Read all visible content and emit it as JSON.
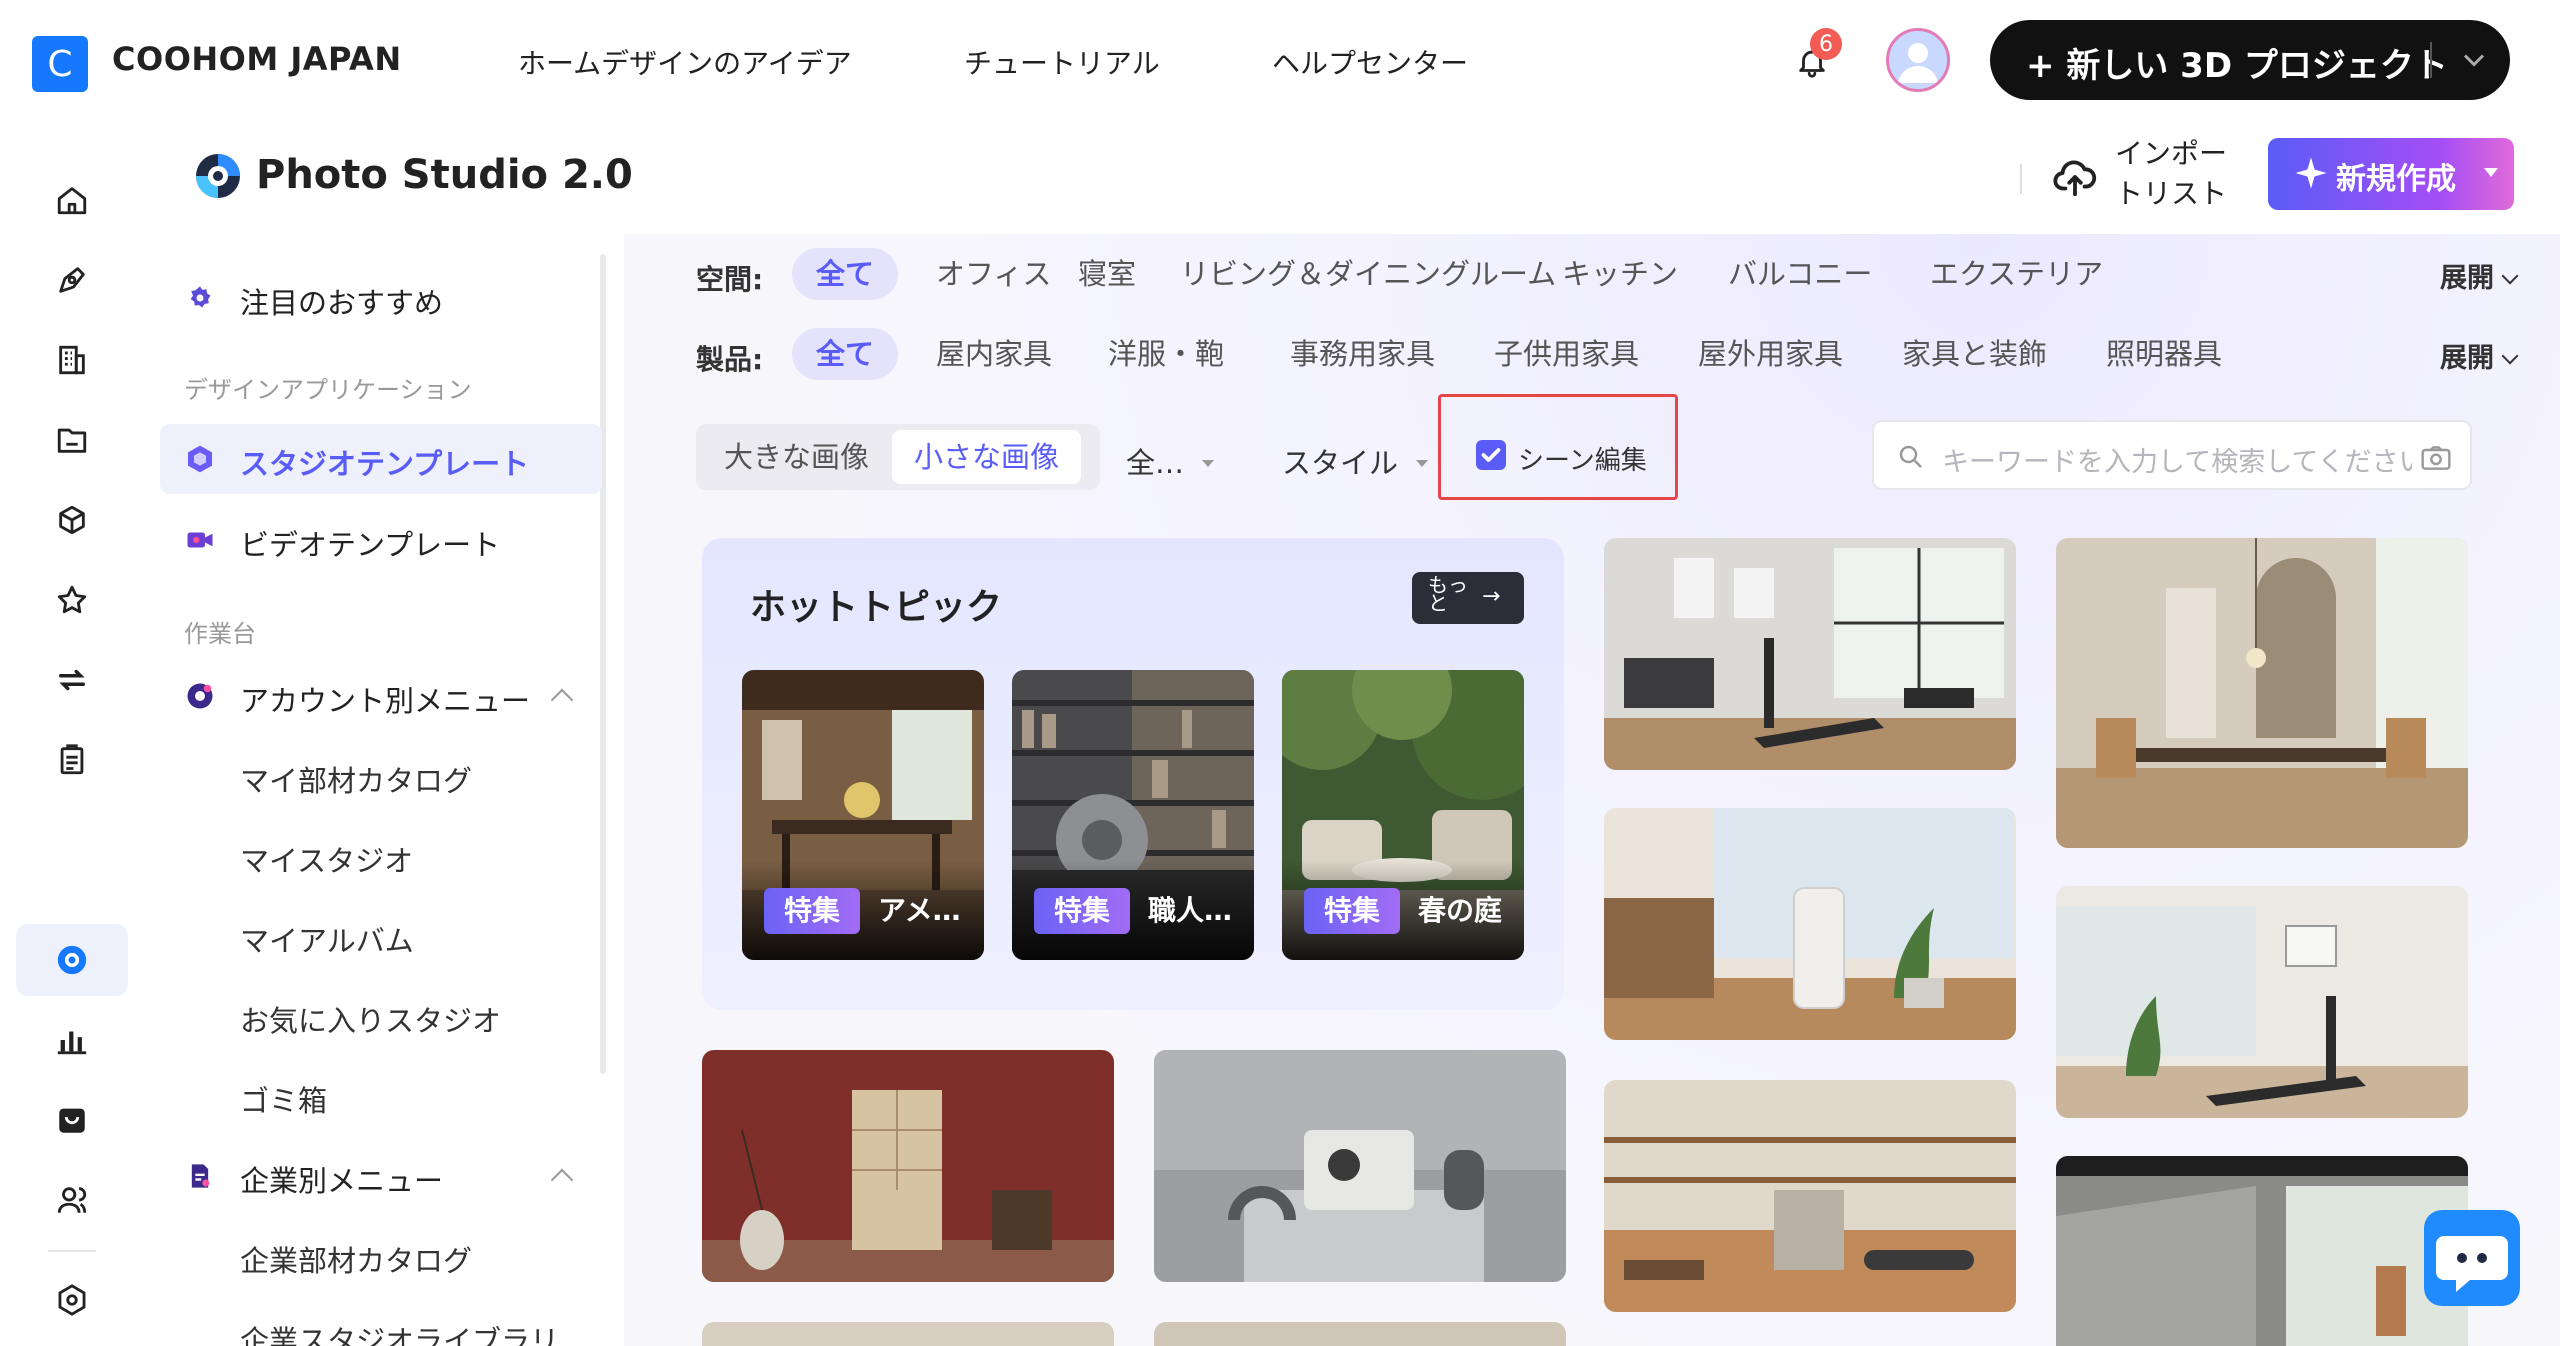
{
  "topbar": {
    "logo_letter": "C",
    "brand": "COOHOM JAPAN",
    "nav": [
      "ホームデザインのアイデア",
      "チュートリアル",
      "ヘルプセンター"
    ],
    "notification_count": "6",
    "new_project_label": "+ 新しい 3D プロジェクト"
  },
  "header": {
    "title": "Photo Studio 2.0",
    "import_label_1": "インポー",
    "import_label_2": "トリスト",
    "create_label": "新規作成"
  },
  "sidebar": {
    "featured": "注目のおすすめ",
    "section_apps": "デザインアプリケーション",
    "studio_template": "スタジオテンプレート",
    "video_template": "ビデオテンプレート",
    "section_workbench": "作業台",
    "account_menu": "アカウント別メニュー",
    "account_items": [
      "マイ部材カタログ",
      "マイスタジオ",
      "マイアルバム",
      "お気に入りスタジオ",
      "ゴミ箱"
    ],
    "enterprise_menu": "企業別メニュー",
    "enterprise_items": [
      "企業部材カタログ",
      "企業スタジオライブラリ"
    ]
  },
  "filters": {
    "space_label": "空間:",
    "space_chips": [
      "全て",
      "オフィス",
      "寝室",
      "リビング＆ダイニングルーム",
      "キッチン",
      "バルコニー",
      "エクステリア"
    ],
    "product_label": "製品:",
    "product_chips": [
      "全て",
      "屋内家具",
      "洋服・鞄",
      "事務用家具",
      "子供用家具",
      "屋外用家具",
      "家具と装飾",
      "照明器具"
    ],
    "expand_label": "展開"
  },
  "toolbar": {
    "large_image": "大きな画像",
    "small_image": "小さな画像",
    "dropdown_all": "全…",
    "dropdown_style": "スタイル",
    "scene_edit": "シーン編集",
    "scene_edit_checked": true,
    "search_placeholder": "キーワードを入力して検索してください"
  },
  "hot": {
    "title": "ホットトピック",
    "more": "もっと",
    "cards": [
      {
        "tag": "特集",
        "caption": "アメ…"
      },
      {
        "tag": "特集",
        "caption": "職人…"
      },
      {
        "tag": "特集",
        "caption": "春の庭"
      }
    ]
  },
  "colors": {
    "accent": "#5a5cf7",
    "brand_blue": "#1677ff",
    "highlight_red": "#e5464a",
    "notification_red": "#f25c54"
  }
}
